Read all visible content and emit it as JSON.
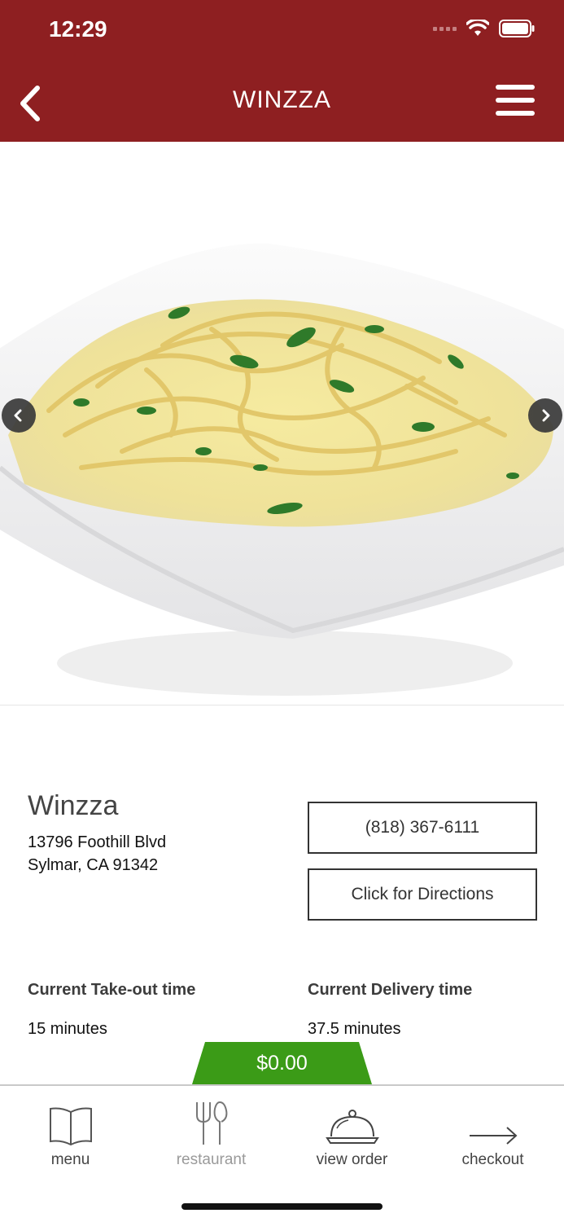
{
  "status_bar": {
    "time": "12:29"
  },
  "nav": {
    "title": "WINZZA"
  },
  "hero": {
    "image": "fettuccine-alfredo-photo"
  },
  "restaurant": {
    "name": "Winzza",
    "address_line1": "13796 Foothill Blvd",
    "address_line2": "Sylmar, CA 91342",
    "phone": "(818) 367-6111",
    "directions_label": "Click for Directions"
  },
  "times": {
    "takeout_label": "Current Take-out time",
    "takeout_value": "15 minutes",
    "delivery_label": "Current Delivery time",
    "delivery_value": "37.5 minutes"
  },
  "cart": {
    "total": "$0.00"
  },
  "tabs": [
    {
      "label": "menu",
      "icon": "book-icon"
    },
    {
      "label": "restaurant",
      "icon": "fork-knife-icon"
    },
    {
      "label": "view order",
      "icon": "cloche-icon"
    },
    {
      "label": "checkout",
      "icon": "arrow-right-icon"
    }
  ],
  "colors": {
    "brand": "#8e1f21",
    "accent_green": "#3b9b17"
  }
}
